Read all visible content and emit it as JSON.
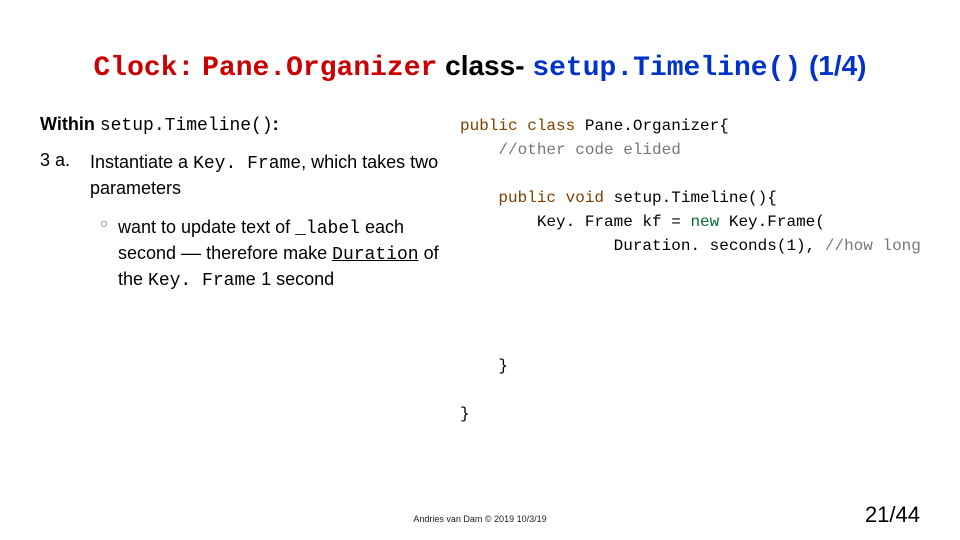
{
  "title": {
    "t1": "Clock:",
    "t2": "Pane.Organizer",
    "t3": "class-",
    "t4": "setup.Timeline()",
    "t5": "(1/4)"
  },
  "within": {
    "prefix": "Within ",
    "code": "setup.Timeline()",
    "suffix": ":"
  },
  "step": {
    "num": "3 a.",
    "line1a": "Instantiate a ",
    "line1code": "Key. Frame",
    "line1b": ", which takes two parameters"
  },
  "bullet": "○",
  "sub": {
    "p1": "want to update text of ",
    "c1": "_label",
    "p2": " each second –– therefore make ",
    "c2": "Duration",
    "p3": " of the ",
    "c3": "Key. Frame",
    "p4": " 1 second"
  },
  "code": {
    "l1a": "public",
    "l1b": " ",
    "l1c": "class",
    "l1d": " Pane.Organizer{",
    "l2": "    //other code elided",
    "l3": "",
    "l4a": "    ",
    "l4b": "public",
    "l4c": " ",
    "l4d": "void",
    "l4e": " setup.Timeline(){",
    "l5a": "        Key. Frame kf = ",
    "l5b": "new",
    "l5c": " Key.Frame(",
    "l6a": "                Duration. seconds(1), ",
    "l6b": "//how long",
    "l7": "",
    "l8": "",
    "l9": "",
    "l10": "",
    "l11": "    }",
    "l12": "",
    "l13": "}"
  },
  "footer": {
    "credit": "Andries van Dam © 2019 10/3/19",
    "page": "21/44"
  }
}
